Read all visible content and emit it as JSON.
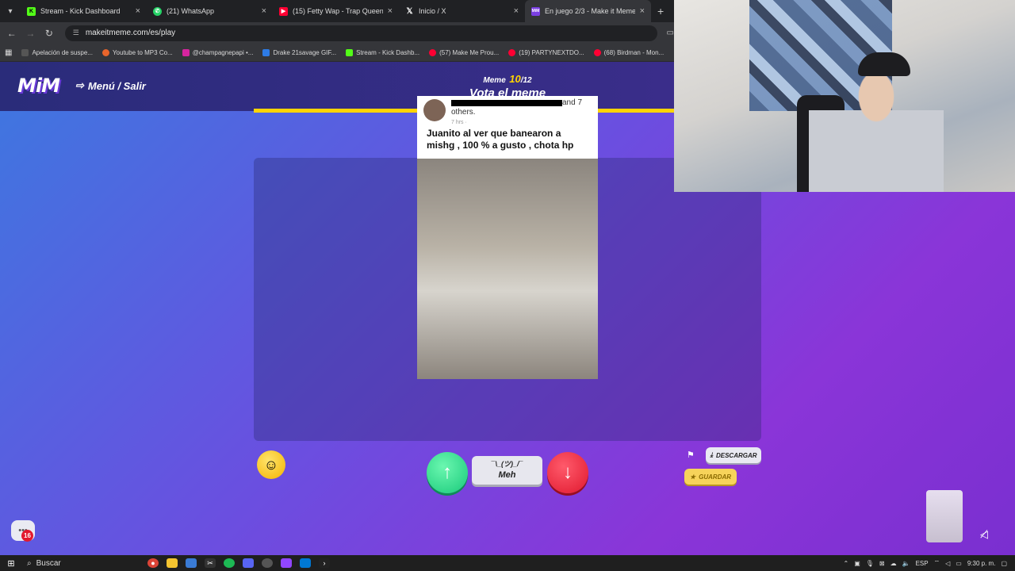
{
  "browser": {
    "tabs": [
      {
        "title": "Stream - Kick Dashboard",
        "icon": "kick-icon",
        "color": "#53fc18",
        "active": false
      },
      {
        "title": "(21) WhatsApp",
        "icon": "whatsapp-icon",
        "color": "#25d366",
        "active": false
      },
      {
        "title": "(15) Fetty Wap - Trap Queen (O",
        "icon": "youtube-icon",
        "color": "#ff0033",
        "active": false
      },
      {
        "title": "Inicio / X",
        "icon": "x-icon",
        "color": "#000000",
        "active": false
      },
      {
        "title": "En juego 2/3 - Make it Meme",
        "icon": "mim-icon",
        "color": "#7b3fe4",
        "active": true
      }
    ],
    "url": "makeitmeme.com/es/play",
    "bookmarks": [
      {
        "label": "Apelación de suspe...",
        "color": "#555555"
      },
      {
        "label": "Youtube to MP3 Co...",
        "color": "#e8652b"
      },
      {
        "label": "@champagnepapi •...",
        "color": "#d6249f"
      },
      {
        "label": "Drake 21savage GIF...",
        "color": "#2d7be5"
      },
      {
        "label": "Stream - Kick Dashb...",
        "color": "#53fc18"
      },
      {
        "label": "(57) Make Me Prou...",
        "color": "#ff0033"
      },
      {
        "label": "(19) PARTYNEXTDO...",
        "color": "#ff0033"
      },
      {
        "label": "(68) Birdman - Mon...",
        "color": "#ff0033"
      }
    ]
  },
  "game": {
    "logo": "MiM",
    "menu_exit": "Menú / Salir",
    "round_label": "Meme",
    "round_current": "10",
    "round_total": "/12",
    "phase_title": "Vota el meme",
    "progress_fraction": 1.0
  },
  "meme": {
    "post_and": "and 7",
    "post_others": "others.",
    "post_time": "7 hrs · ",
    "caption": "Juanito al ver que banearon a mishg , 100 % a gusto , chota hp"
  },
  "actions": {
    "meh_shrug": "¯\\_(ツ)_/¯",
    "meh_label": "Meh",
    "download_label": "DESCARGAR",
    "save_label": "GUARDAR",
    "chat_badge": "16"
  },
  "taskbar": {
    "search_placeholder": "Buscar",
    "language": "ESP",
    "time": "9:30 p. m."
  },
  "colors": {
    "accent": "#ffd400",
    "upvote": "#18c97a",
    "downvote": "#e0182e"
  }
}
